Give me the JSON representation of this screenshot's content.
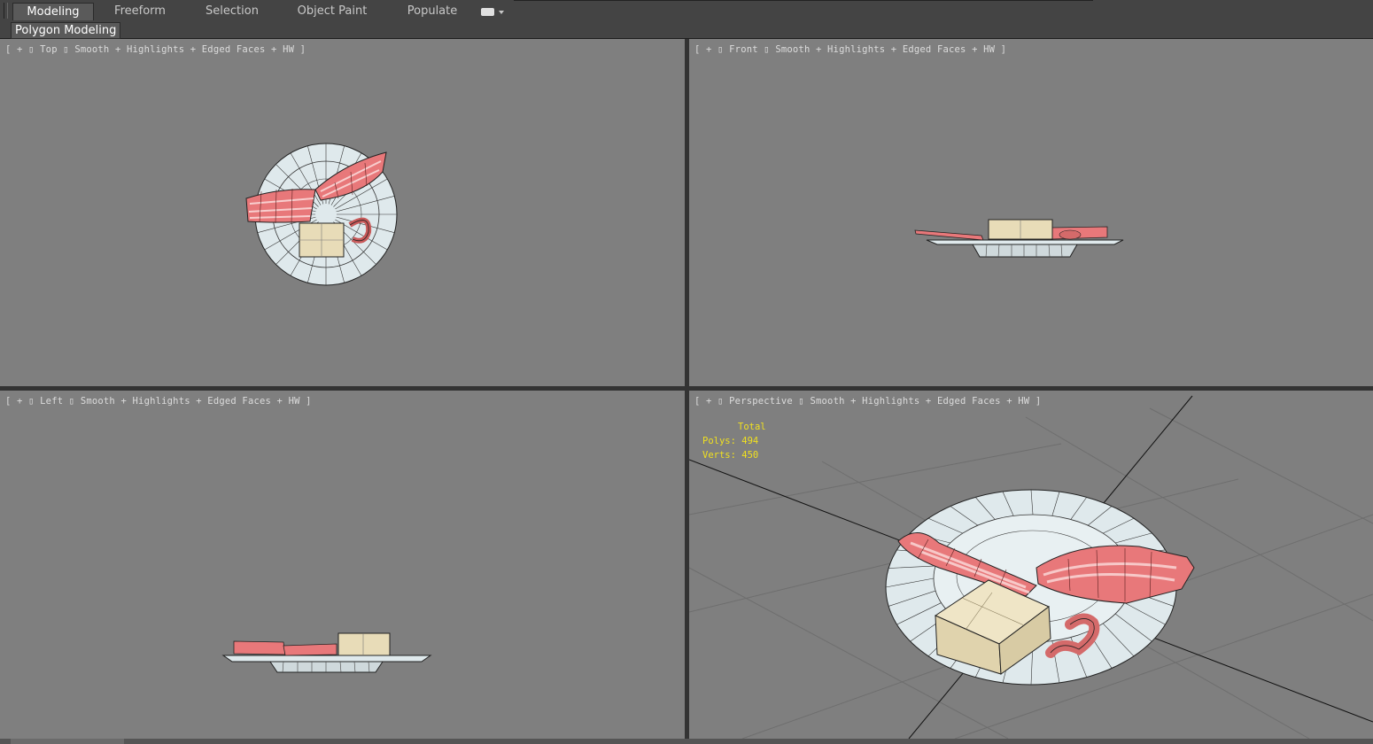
{
  "ribbon": {
    "tabs": [
      {
        "label": "Modeling",
        "active": true
      },
      {
        "label": "Freeform",
        "active": false
      },
      {
        "label": "Selection",
        "active": false
      },
      {
        "label": "Object Paint",
        "active": false
      },
      {
        "label": "Populate",
        "active": false
      }
    ],
    "toggle_icon": "ribbon-display-toggle-icon",
    "panel_label": "Polygon Modeling"
  },
  "viewports": {
    "top": {
      "bracket_open": "[ +",
      "view_name": "Top",
      "shading": "Smooth + Highlights + Edged Faces + HW ]"
    },
    "front": {
      "bracket_open": "[ +",
      "view_name": "Front",
      "shading": "Smooth + Highlights + Edged Faces + HW ]"
    },
    "left": {
      "bracket_open": "[ +",
      "view_name": "Left",
      "shading": "Smooth + Highlights + Edged Faces + HW ]"
    },
    "perspective": {
      "bracket_open": "[ +",
      "view_name": "Perspective",
      "shading": "Smooth + Highlights + Edged Faces + HW ]",
      "stats": {
        "title": "Total",
        "polys": "Polys: 494",
        "verts": "Verts: 450"
      }
    }
  },
  "colors": {
    "viewport_bg": "#7f7f7f",
    "plate": "#dfe9ec",
    "meat": "#e8787a",
    "cheese": "#e8dcb8",
    "stats_text": "#f0e020",
    "active_tab": "#5a5a5a"
  }
}
